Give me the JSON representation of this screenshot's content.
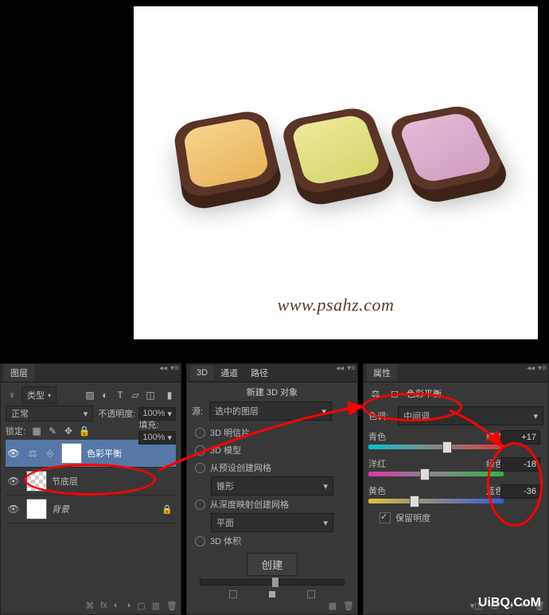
{
  "canvas": {
    "watermark": "www.psahz.com",
    "watermark2": "UiBQ.CoM"
  },
  "layers_panel": {
    "tab": "图层",
    "type_label": "类型",
    "blend_mode": "正常",
    "opacity_label": "不透明度:",
    "opacity_value": "100%",
    "lock_label": "锁定:",
    "fill_label": "填充:",
    "fill_value": "100%",
    "layers": [
      {
        "name": "色彩平衡",
        "selected": true,
        "has_mask": true,
        "link": true
      },
      {
        "name": "节底层",
        "checker": true
      },
      {
        "name": "背景",
        "locked": true
      }
    ]
  },
  "threeD_panel": {
    "tabs": [
      "3D",
      "通道",
      "路径"
    ],
    "new_obj_label": "新建 3D 对象",
    "source_label": "源:",
    "source_value": "选中的图层",
    "options": {
      "postcard": "3D 明信片",
      "model": "3D 模型",
      "mesh_preset": "从预设创建网格",
      "mesh_preset_value": "锥形",
      "mesh_depth": "从深度映射创建网格",
      "mesh_depth_value": "平面",
      "volume": "3D 体积"
    },
    "create_btn": "创建"
  },
  "props_panel": {
    "tab": "属性",
    "adj_title": "色彩平衡",
    "tone_label": "色调:",
    "tone_value": "中间调",
    "sliders": [
      {
        "left": "青色",
        "right": "红色",
        "value": "+17",
        "pos": 58
      },
      {
        "left": "洋红",
        "right": "绿色",
        "value": "-18",
        "pos": 42
      },
      {
        "left": "黄色",
        "right": "蓝色",
        "value": "-36",
        "pos": 34
      }
    ],
    "preserve_lum": "保留明度"
  }
}
